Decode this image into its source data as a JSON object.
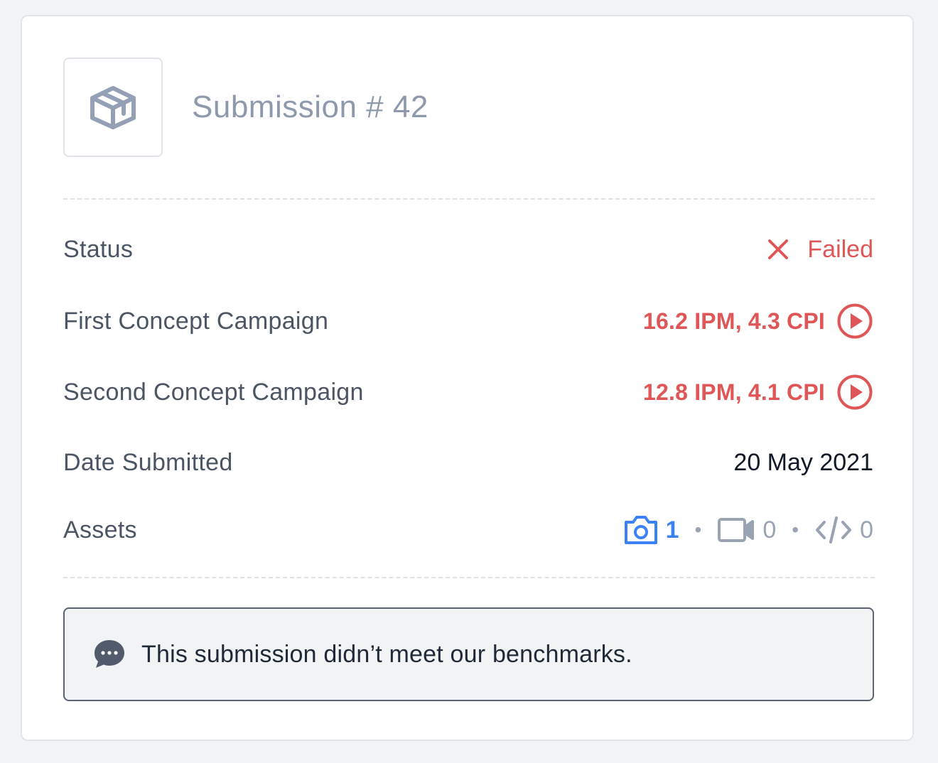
{
  "header": {
    "title": "Submission # 42",
    "logo_icon": "package-box-icon"
  },
  "details": {
    "status": {
      "label": "Status",
      "value": "Failed",
      "icon": "close-x-icon",
      "color": "#e05556"
    },
    "first_campaign": {
      "label": "First Concept Campaign",
      "value": "16.2 IPM, 4.3 CPI",
      "icon": "play-circle-icon"
    },
    "second_campaign": {
      "label": "Second Concept Campaign",
      "value": "12.8 IPM, 4.1 CPI",
      "icon": "play-circle-icon"
    },
    "date_submitted": {
      "label": "Date Submitted",
      "value": "20 May 2021"
    },
    "assets": {
      "label": "Assets",
      "images": {
        "icon": "camera-icon",
        "count": "1",
        "color": "#3b82f6"
      },
      "videos": {
        "icon": "video-camera-icon",
        "count": "0"
      },
      "code": {
        "icon": "code-icon",
        "count": "0"
      },
      "separator": "•"
    }
  },
  "note": {
    "icon": "chat-bubble-icon",
    "text": "This submission didn’t meet our benchmarks."
  },
  "colors": {
    "accent_red": "#e05556",
    "accent_blue": "#3b82f6",
    "muted": "#9aa3b2"
  }
}
